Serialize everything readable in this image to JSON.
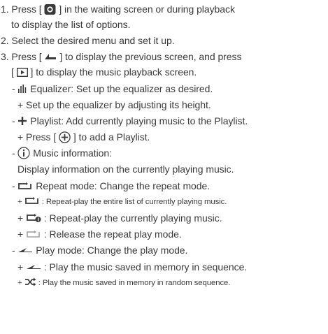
{
  "steps": {
    "s1_pre": "1. Press [",
    "s1_post": "] in the waiting screen or during playback",
    "s1_cont": "to display the list of options.",
    "s2": "2. Select the desired menu and set it up.",
    "s3_pre": "3. Press [",
    "s3_post": "] to display the previous screen, and press",
    "s3_cont_open": "[",
    "s3_cont_post": "] to display the music playback screen."
  },
  "equalizer": {
    "title_pre": "- ",
    "title": "Equalizer: Set up the equalizer as desired.",
    "sub": "+ Set up the equalizer by adjusting its height."
  },
  "playlist": {
    "title_pre": "- ",
    "title": "Playlist: Add currently playing music to the Playlist.",
    "sub_pre": "+ Press [",
    "sub_post": "] to add a Playlist."
  },
  "music_info": {
    "title_pre": "- ",
    "title": "Music information:",
    "sub": "Display information on the currently playing music."
  },
  "repeat": {
    "title_pre": "- ",
    "title": "Repeat mode: Change the repeat mode.",
    "items": [
      {
        "prefix": "+ ",
        "text": ": Repeat-play the entire list of currently playing music."
      },
      {
        "prefix": "+ ",
        "text": ": Repeat-play the currently playing music."
      },
      {
        "prefix": "+ ",
        "text": ": Release the repeat play mode."
      }
    ]
  },
  "play_mode": {
    "title_pre": "- ",
    "title": "Play mode: Change the play mode.",
    "items": [
      {
        "prefix": "+ ",
        "text": ": Play the music saved in memory in sequence."
      },
      {
        "prefix": "+ ",
        "text": ": Play the music saved in memory in random sequence."
      }
    ]
  }
}
